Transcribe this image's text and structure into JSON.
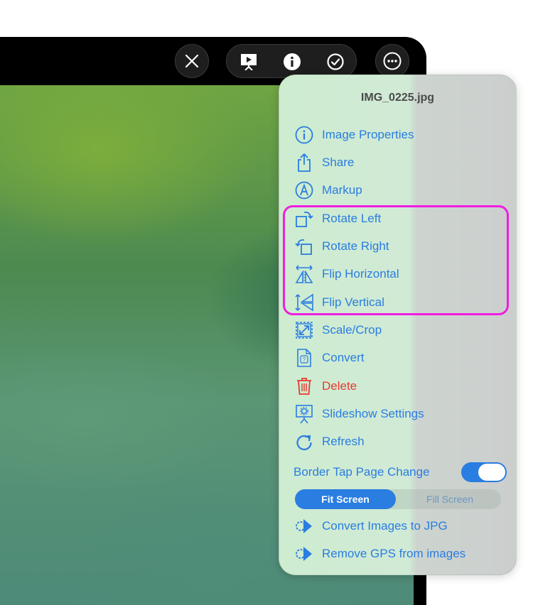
{
  "menu": {
    "title": "IMG_0225.jpg",
    "items": [
      {
        "label": "Image Properties",
        "icon": "info-circle-icon"
      },
      {
        "label": "Share",
        "icon": "share-icon"
      },
      {
        "label": "Markup",
        "icon": "markup-icon"
      },
      {
        "label": "Rotate Left",
        "icon": "rotate-left-icon"
      },
      {
        "label": "Rotate Right",
        "icon": "rotate-right-icon"
      },
      {
        "label": "Flip Horizontal",
        "icon": "flip-horizontal-icon"
      },
      {
        "label": "Flip Vertical",
        "icon": "flip-vertical-icon"
      },
      {
        "label": "Scale/Crop",
        "icon": "scale-crop-icon"
      },
      {
        "label": "Convert",
        "icon": "convert-icon"
      },
      {
        "label": "Delete",
        "icon": "trash-icon"
      },
      {
        "label": "Slideshow Settings",
        "icon": "slideshow-settings-icon"
      },
      {
        "label": "Refresh",
        "icon": "refresh-icon"
      }
    ],
    "toggle": {
      "label": "Border Tap Page Change",
      "on": true
    },
    "segment": {
      "options": [
        "Fit Screen",
        "Fill Screen"
      ],
      "selected": "Fit Screen"
    },
    "extensions": [
      {
        "label": "Convert Images to JPG",
        "icon": "extension-gear-icon"
      },
      {
        "label": "Remove GPS from images",
        "icon": "extension-gear-icon"
      }
    ]
  },
  "toolbar": {
    "icons": [
      "close-icon",
      "slideshow-icon",
      "info-icon",
      "checkmark-icon",
      "more-icon"
    ]
  },
  "colors": {
    "accent": "#2a7de1",
    "destructive": "#e53b30",
    "highlight": "#f01de1"
  }
}
